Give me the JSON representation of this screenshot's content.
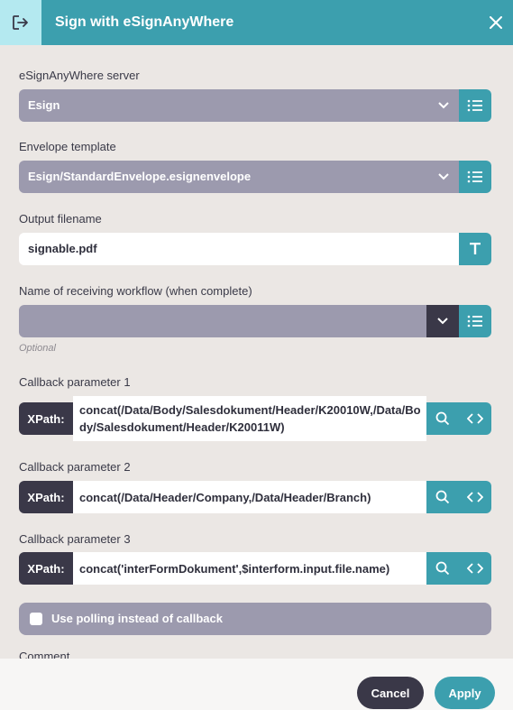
{
  "dialog": {
    "title": "Sign with eSignAnyWhere",
    "header_icon": "sign-out-icon",
    "close_icon": "close-icon"
  },
  "fields": {
    "server": {
      "label": "eSignAnyWhere server",
      "value": "Esign"
    },
    "envelope": {
      "label": "Envelope template",
      "value": "Esign/StandardEnvelope.esignenvelope"
    },
    "output": {
      "label": "Output filename",
      "value": "signable.pdf"
    },
    "workflow": {
      "label": "Name of receiving workflow (when complete)",
      "value": "",
      "hint": "Optional"
    },
    "callback1": {
      "label": "Callback parameter 1",
      "prefix": "XPath:",
      "value": "concat(/Data/Body/Salesdokument/Header/K20010W,/Data/Body/Salesdokument/Header/K20011W)"
    },
    "callback2": {
      "label": "Callback parameter 2",
      "prefix": "XPath:",
      "value": "concat(/Data/Header/Company,/Data/Header/Branch)"
    },
    "callback3": {
      "label": "Callback parameter 3",
      "prefix": "XPath:",
      "value": "concat('interFormDokument',$interform.input.file.name)"
    },
    "polling": {
      "label": "Use polling instead of callback",
      "checked": false
    },
    "comment": {
      "label": "Comment"
    }
  },
  "footer": {
    "cancel_label": "Cancel",
    "apply_label": "Apply"
  },
  "colors": {
    "accent": "#3c9fae",
    "dark": "#3a3848",
    "select_bg": "#9c9aae",
    "background": "#ebe7e4"
  }
}
